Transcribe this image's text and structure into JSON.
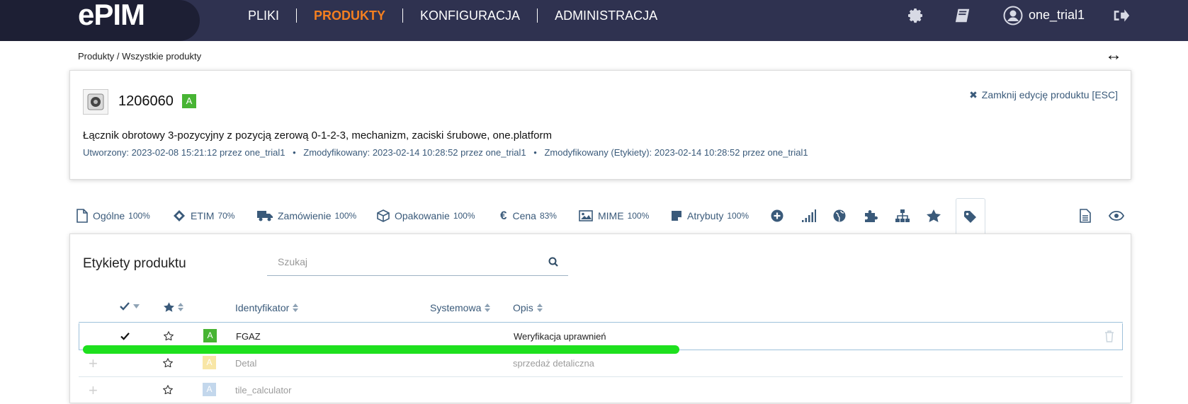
{
  "app": {
    "logo": "ePIM",
    "nav": [
      "PLIKI",
      "PRODUKTY",
      "KONFIGURACJA",
      "ADMINISTRACJA"
    ],
    "active_nav": "PRODUKTY",
    "user": "one_trial1",
    "accent_color": "#f47f20",
    "header_color": "#2f3250"
  },
  "breadcrumb": "Produkty / Wszystkie produkty",
  "product": {
    "id": "1206060",
    "status_badge": "A",
    "close_label": "Zamknij edycję produktu [ESC]",
    "description": "Łącznik obrotowy 3-pozycyjny z pozycją zerową 0-1-2-3, mechanizm, zaciski śrubowe, one.platform",
    "created": "Utworzony: 2023-02-08 15:21:12 przez one_trial1",
    "modified": "Zmodyfikowany: 2023-02-14 10:28:52 przez one_trial1",
    "modified_labels": "Zmodyfikowany (Etykiety): 2023-02-14 10:28:52 przez one_trial1",
    "meta_separator": "•"
  },
  "tabs": [
    {
      "label": "Ogólne",
      "pct": "100%",
      "icon": "document-icon"
    },
    {
      "label": "ETIM",
      "pct": "70%",
      "icon": "etim-icon"
    },
    {
      "label": "Zamówienie",
      "pct": "100%",
      "icon": "truck-icon"
    },
    {
      "label": "Opakowanie",
      "pct": "100%",
      "icon": "box-icon"
    },
    {
      "label": "Cena",
      "pct": "83%",
      "icon": "euro-icon"
    },
    {
      "label": "MIME",
      "pct": "100%",
      "icon": "image-icon"
    },
    {
      "label": "Atrybuty",
      "pct": "100%",
      "icon": "sticky-note-icon"
    }
  ],
  "labels_panel": {
    "title": "Etykiety produktu",
    "search_placeholder": "Szukaj",
    "columns": [
      "Identyfikator",
      "Systemowa",
      "Opis"
    ],
    "rows": [
      {
        "badge": "A",
        "identifier": "FGAZ",
        "description": "Weryfikacja uprawnień",
        "assigned": true
      },
      {
        "badge": "A",
        "identifier": "Detal",
        "description": "sprzedaż detaliczna",
        "assigned": false
      },
      {
        "badge": "A",
        "identifier": "tile_calculator",
        "description": "",
        "assigned": false
      }
    ]
  }
}
